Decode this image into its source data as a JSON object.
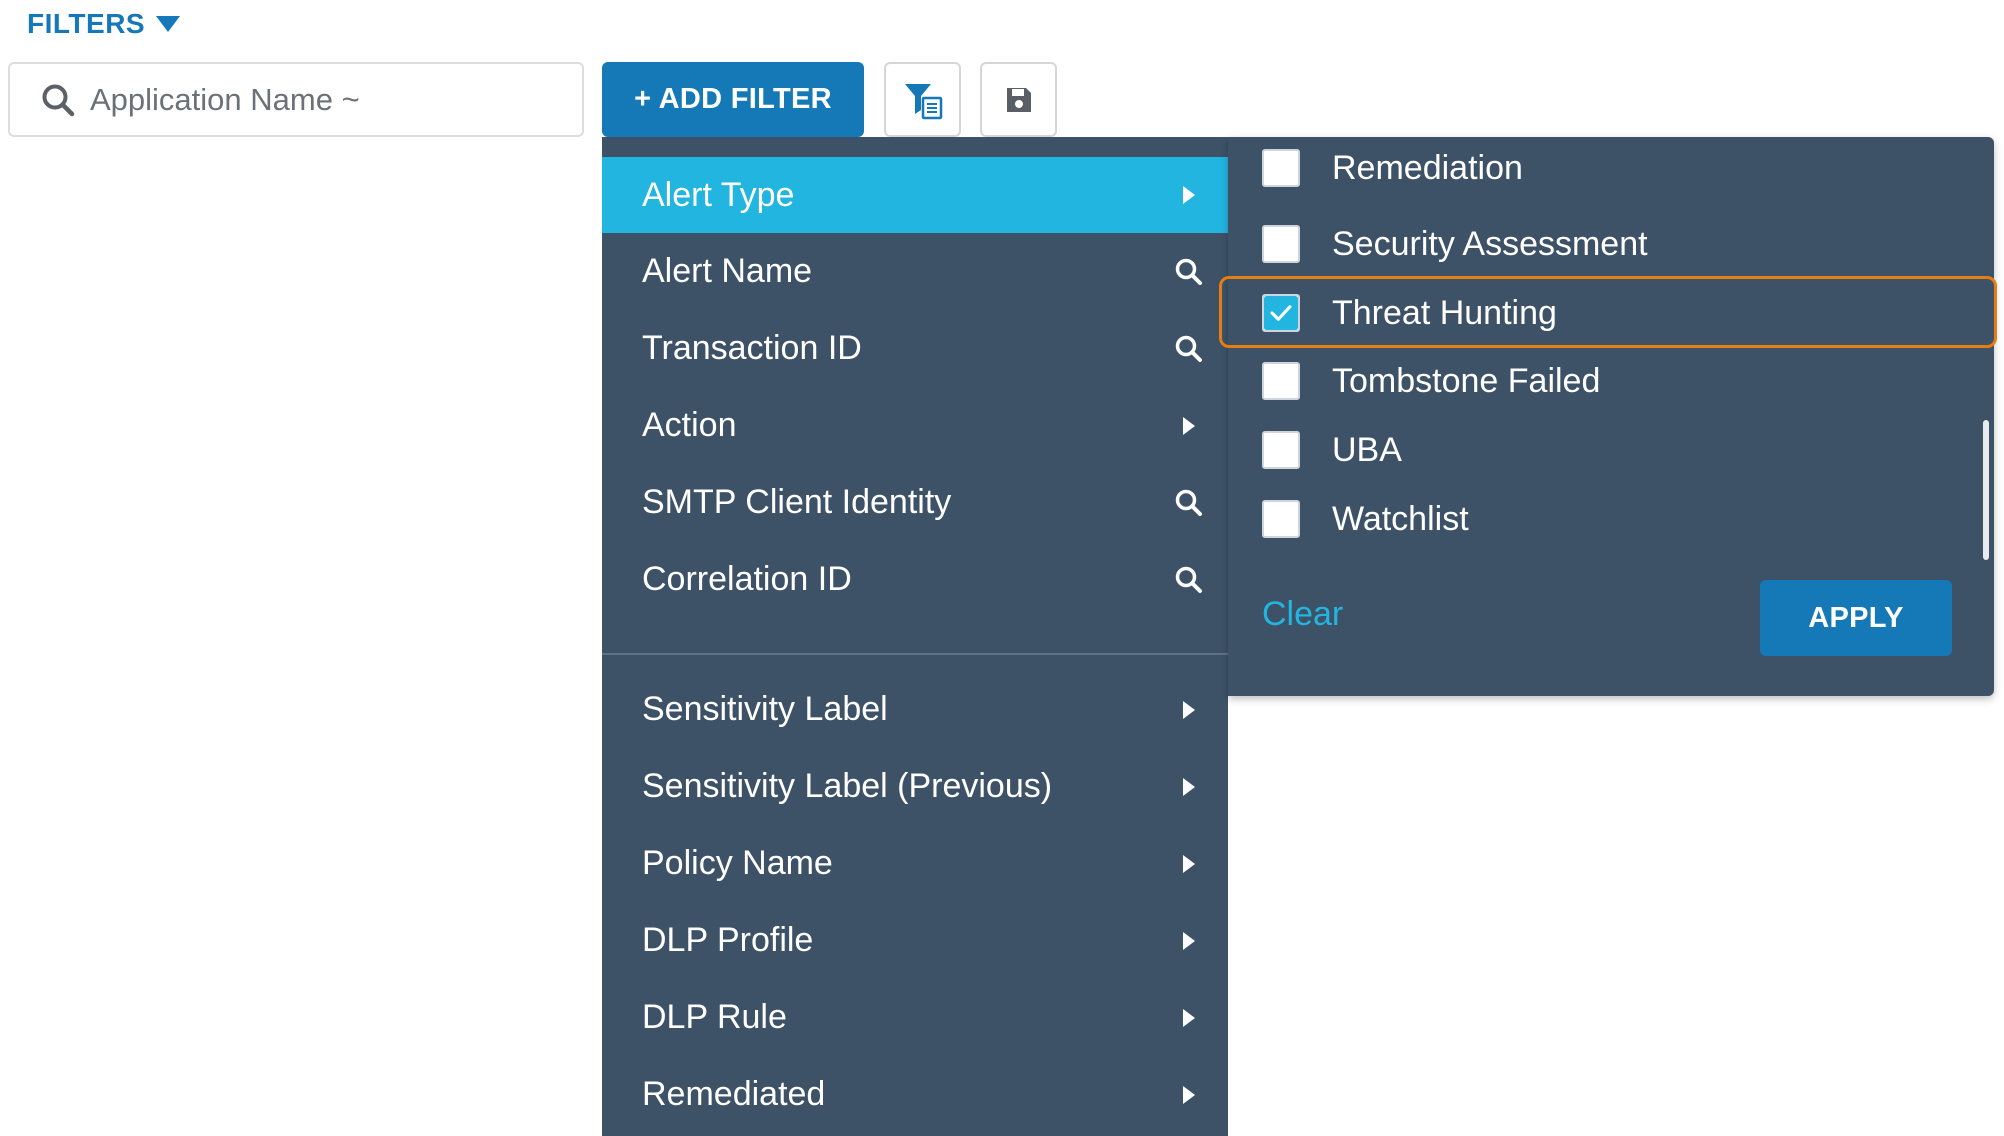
{
  "filters": {
    "label": "FILTERS",
    "toggle_icon": "caret-down-icon"
  },
  "search": {
    "placeholder": "Application Name ~",
    "value": ""
  },
  "toolbar": {
    "add_filter_label": "+ ADD FILTER",
    "filter_list_icon": "filter-list-icon",
    "save_icon": "floppy-disk-icon"
  },
  "menu": {
    "items": [
      {
        "label": "Alert Type",
        "trail": "chevron-right-icon",
        "active": true
      },
      {
        "label": "Alert Name",
        "trail": "search-icon"
      },
      {
        "label": "Transaction ID",
        "trail": "search-icon"
      },
      {
        "label": "Action",
        "trail": "chevron-right-icon"
      },
      {
        "label": "SMTP Client Identity",
        "trail": "search-icon"
      },
      {
        "label": "Correlation ID",
        "trail": "search-icon"
      }
    ],
    "items2": [
      {
        "label": "Sensitivity Label",
        "trail": "chevron-right-icon"
      },
      {
        "label": "Sensitivity Label (Previous)",
        "trail": "chevron-right-icon"
      },
      {
        "label": "Policy Name",
        "trail": "chevron-right-icon"
      },
      {
        "label": "DLP Profile",
        "trail": "chevron-right-icon"
      },
      {
        "label": "DLP Rule",
        "trail": "chevron-right-icon"
      },
      {
        "label": "Remediated",
        "trail": "chevron-right-icon"
      }
    ]
  },
  "submenu": {
    "options": [
      {
        "label": "Remediation",
        "checked": false
      },
      {
        "label": "Security Assessment",
        "checked": false
      },
      {
        "label": "Threat Hunting",
        "checked": true
      },
      {
        "label": "Tombstone Failed",
        "checked": false
      },
      {
        "label": "UBA",
        "checked": false
      },
      {
        "label": "Watchlist",
        "checked": false
      }
    ],
    "clear_label": "Clear",
    "apply_label": "APPLY"
  },
  "colors": {
    "brand_blue": "#1579b8",
    "menu_bg": "#3e5267",
    "active_item": "#22b5e0",
    "highlight": "#e47d14"
  }
}
